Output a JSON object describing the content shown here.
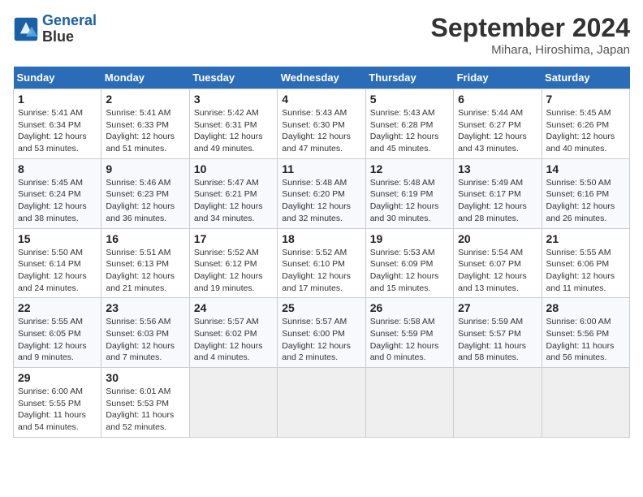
{
  "app": {
    "logo_line1": "General",
    "logo_line2": "Blue"
  },
  "header": {
    "title": "September 2024",
    "subtitle": "Mihara, Hiroshima, Japan"
  },
  "calendar": {
    "columns": [
      "Sunday",
      "Monday",
      "Tuesday",
      "Wednesday",
      "Thursday",
      "Friday",
      "Saturday"
    ],
    "weeks": [
      [
        {
          "day": "",
          "text": ""
        },
        {
          "day": "",
          "text": ""
        },
        {
          "day": "",
          "text": ""
        },
        {
          "day": "",
          "text": ""
        },
        {
          "day": "",
          "text": ""
        },
        {
          "day": "",
          "text": ""
        },
        {
          "day": "",
          "text": ""
        }
      ],
      [
        {
          "day": "1",
          "text": "Sunrise: 5:41 AM\nSunset: 6:34 PM\nDaylight: 12 hours\nand 53 minutes."
        },
        {
          "day": "2",
          "text": "Sunrise: 5:41 AM\nSunset: 6:33 PM\nDaylight: 12 hours\nand 51 minutes."
        },
        {
          "day": "3",
          "text": "Sunrise: 5:42 AM\nSunset: 6:31 PM\nDaylight: 12 hours\nand 49 minutes."
        },
        {
          "day": "4",
          "text": "Sunrise: 5:43 AM\nSunset: 6:30 PM\nDaylight: 12 hours\nand 47 minutes."
        },
        {
          "day": "5",
          "text": "Sunrise: 5:43 AM\nSunset: 6:28 PM\nDaylight: 12 hours\nand 45 minutes."
        },
        {
          "day": "6",
          "text": "Sunrise: 5:44 AM\nSunset: 6:27 PM\nDaylight: 12 hours\nand 43 minutes."
        },
        {
          "day": "7",
          "text": "Sunrise: 5:45 AM\nSunset: 6:26 PM\nDaylight: 12 hours\nand 40 minutes."
        }
      ],
      [
        {
          "day": "8",
          "text": "Sunrise: 5:45 AM\nSunset: 6:24 PM\nDaylight: 12 hours\nand 38 minutes."
        },
        {
          "day": "9",
          "text": "Sunrise: 5:46 AM\nSunset: 6:23 PM\nDaylight: 12 hours\nand 36 minutes."
        },
        {
          "day": "10",
          "text": "Sunrise: 5:47 AM\nSunset: 6:21 PM\nDaylight: 12 hours\nand 34 minutes."
        },
        {
          "day": "11",
          "text": "Sunrise: 5:48 AM\nSunset: 6:20 PM\nDaylight: 12 hours\nand 32 minutes."
        },
        {
          "day": "12",
          "text": "Sunrise: 5:48 AM\nSunset: 6:19 PM\nDaylight: 12 hours\nand 30 minutes."
        },
        {
          "day": "13",
          "text": "Sunrise: 5:49 AM\nSunset: 6:17 PM\nDaylight: 12 hours\nand 28 minutes."
        },
        {
          "day": "14",
          "text": "Sunrise: 5:50 AM\nSunset: 6:16 PM\nDaylight: 12 hours\nand 26 minutes."
        }
      ],
      [
        {
          "day": "15",
          "text": "Sunrise: 5:50 AM\nSunset: 6:14 PM\nDaylight: 12 hours\nand 24 minutes."
        },
        {
          "day": "16",
          "text": "Sunrise: 5:51 AM\nSunset: 6:13 PM\nDaylight: 12 hours\nand 21 minutes."
        },
        {
          "day": "17",
          "text": "Sunrise: 5:52 AM\nSunset: 6:12 PM\nDaylight: 12 hours\nand 19 minutes."
        },
        {
          "day": "18",
          "text": "Sunrise: 5:52 AM\nSunset: 6:10 PM\nDaylight: 12 hours\nand 17 minutes."
        },
        {
          "day": "19",
          "text": "Sunrise: 5:53 AM\nSunset: 6:09 PM\nDaylight: 12 hours\nand 15 minutes."
        },
        {
          "day": "20",
          "text": "Sunrise: 5:54 AM\nSunset: 6:07 PM\nDaylight: 12 hours\nand 13 minutes."
        },
        {
          "day": "21",
          "text": "Sunrise: 5:55 AM\nSunset: 6:06 PM\nDaylight: 12 hours\nand 11 minutes."
        }
      ],
      [
        {
          "day": "22",
          "text": "Sunrise: 5:55 AM\nSunset: 6:05 PM\nDaylight: 12 hours\nand 9 minutes."
        },
        {
          "day": "23",
          "text": "Sunrise: 5:56 AM\nSunset: 6:03 PM\nDaylight: 12 hours\nand 7 minutes."
        },
        {
          "day": "24",
          "text": "Sunrise: 5:57 AM\nSunset: 6:02 PM\nDaylight: 12 hours\nand 4 minutes."
        },
        {
          "day": "25",
          "text": "Sunrise: 5:57 AM\nSunset: 6:00 PM\nDaylight: 12 hours\nand 2 minutes."
        },
        {
          "day": "26",
          "text": "Sunrise: 5:58 AM\nSunset: 5:59 PM\nDaylight: 12 hours\nand 0 minutes."
        },
        {
          "day": "27",
          "text": "Sunrise: 5:59 AM\nSunset: 5:57 PM\nDaylight: 11 hours\nand 58 minutes."
        },
        {
          "day": "28",
          "text": "Sunrise: 6:00 AM\nSunset: 5:56 PM\nDaylight: 11 hours\nand 56 minutes."
        }
      ],
      [
        {
          "day": "29",
          "text": "Sunrise: 6:00 AM\nSunset: 5:55 PM\nDaylight: 11 hours\nand 54 minutes."
        },
        {
          "day": "30",
          "text": "Sunrise: 6:01 AM\nSunset: 5:53 PM\nDaylight: 11 hours\nand 52 minutes."
        },
        {
          "day": "",
          "text": ""
        },
        {
          "day": "",
          "text": ""
        },
        {
          "day": "",
          "text": ""
        },
        {
          "day": "",
          "text": ""
        },
        {
          "day": "",
          "text": ""
        }
      ]
    ]
  }
}
